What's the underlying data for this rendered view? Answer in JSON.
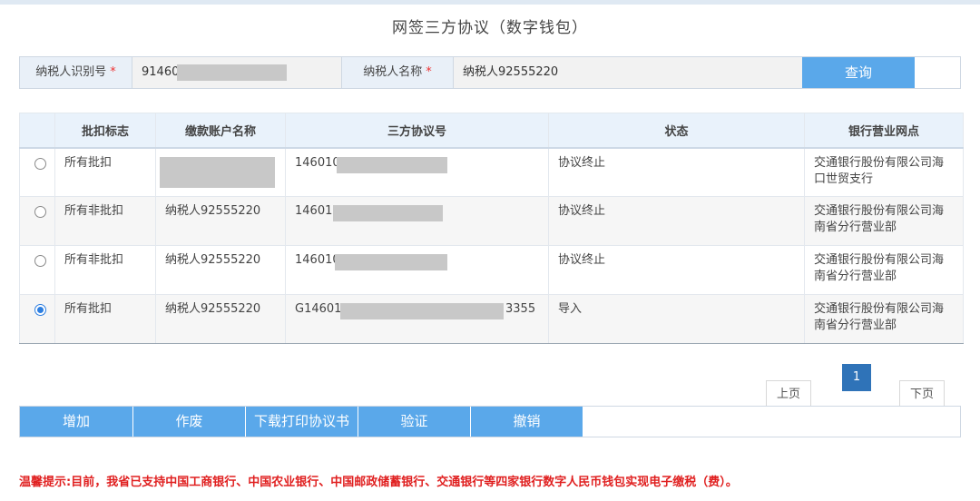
{
  "page": {
    "title": "网签三方协议（数字钱包）"
  },
  "search": {
    "taxpayer_id_label": "纳税人识别号",
    "taxpayer_id_value": "91460",
    "taxpayer_name_label": "纳税人名称",
    "taxpayer_name_value": "纳税人92555220",
    "required_mark": "*",
    "query_label": "查询"
  },
  "table": {
    "headers": [
      "",
      "批扣标志",
      "缴款账户名称",
      "三方协议号",
      "状态",
      "银行营业网点"
    ],
    "rows": [
      {
        "selected": false,
        "flag": "所有批扣",
        "account": "",
        "agreement_prefix": "146010",
        "agreement_suffix": "",
        "status": "协议终止",
        "bank": "交通银行股份有限公司海口世贸支行"
      },
      {
        "selected": false,
        "flag": "所有非批扣",
        "account": "纳税人92555220",
        "agreement_prefix": "14601",
        "agreement_suffix": "",
        "status": "协议终止",
        "bank": "交通银行股份有限公司海南省分行营业部"
      },
      {
        "selected": false,
        "flag": "所有非批扣",
        "account": "纳税人92555220",
        "agreement_prefix": "146010",
        "agreement_suffix": "",
        "status": "协议终止",
        "bank": "交通银行股份有限公司海南省分行营业部"
      },
      {
        "selected": true,
        "flag": "所有批扣",
        "account": "纳税人92555220",
        "agreement_prefix": "G14601",
        "agreement_suffix": "3355",
        "status": "导入",
        "bank": "交通银行股份有限公司海南省分行营业部"
      }
    ]
  },
  "pagination": {
    "prev_label": "上页",
    "current_page": "1",
    "next_label": "下页"
  },
  "actions": {
    "add_label": "增加",
    "void_label": "作废",
    "download_label": "下载打印协议书",
    "verify_label": "验证",
    "revoke_label": "撤销"
  },
  "tip": "温馨提示:目前，我省已支持中国工商银行、中国农业银行、中国邮政储蓄银行、交通银行等四家银行数字人民币钱包实现电子缴税（费）。",
  "colors": {
    "accent": "#5aa8ea",
    "page_active": "#2f73b8",
    "tip_red": "#e02020",
    "header_bg": "#e9f2fb"
  }
}
